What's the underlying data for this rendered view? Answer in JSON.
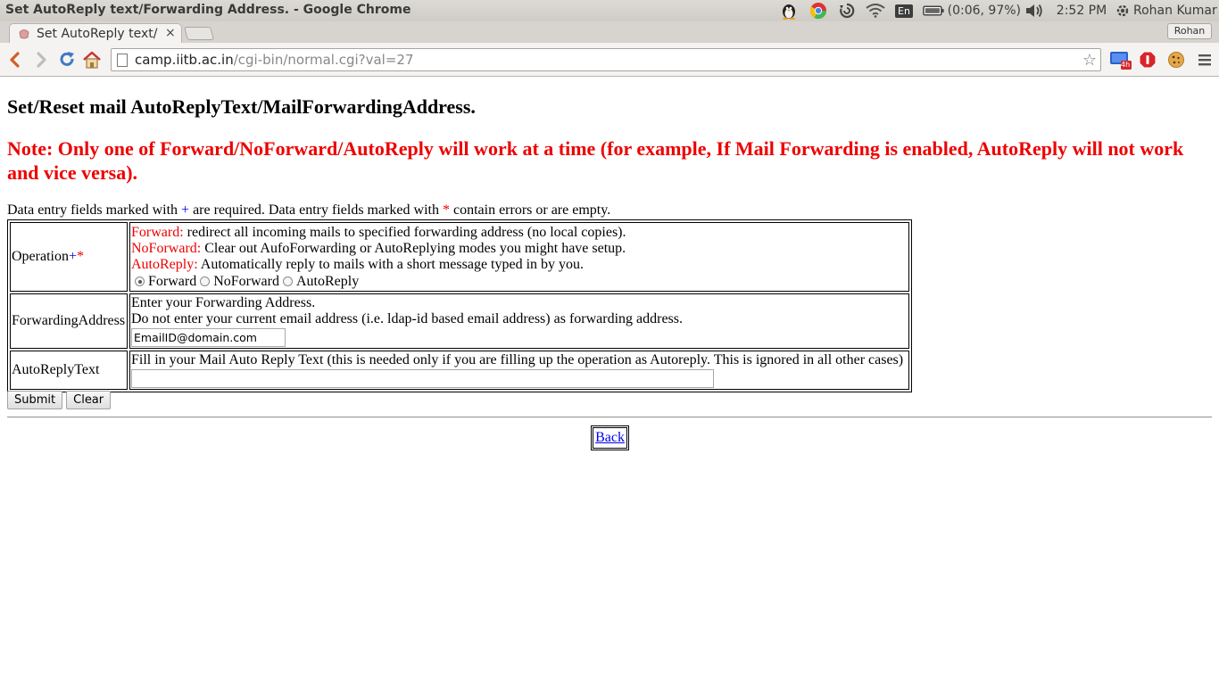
{
  "window": {
    "title": "Set AutoReply text/Forwarding Address. - Google Chrome"
  },
  "tray": {
    "keyboard_layout": "En",
    "battery": "(0:06, 97%)",
    "time": "2:52 PM",
    "user": "Rohan Kumar"
  },
  "tabs": {
    "active_title": "Set AutoReply text/F",
    "close_glyph": "×",
    "profile": "Rohan"
  },
  "omnibox": {
    "host": "camp.iitb.ac.in",
    "path": "/cgi-bin/normal.cgi?val=27"
  },
  "extension_badge": "4h",
  "page": {
    "heading": "Set/Reset mail AutoReplyText/MailForwardingAddress.",
    "note": "Note: Only one of Forward/NoForward/AutoReply will work at a time (for example, If Mail Forwarding is enabled, AutoReply will not work and vice versa).",
    "legend": {
      "part1": "Data entry fields marked with ",
      "plus": "+",
      "part2": " are required. Data entry fields marked with ",
      "star": "*",
      "part3": " contain errors or are empty."
    },
    "operation": {
      "label": "Operation",
      "plus": "+",
      "star": "*",
      "lines": [
        {
          "name": "Forward:",
          "desc": " redirect all incoming mails to specified forwarding address (no local copies)."
        },
        {
          "name": "NoForward:",
          "desc": " Clear out AufoForwarding or AutoReplying modes you might have setup."
        },
        {
          "name": "AutoReply:",
          "desc": " Automatically reply to mails with a short message typed in by you."
        }
      ],
      "options": [
        "Forward",
        "NoForward",
        "AutoReply"
      ],
      "selected": "Forward"
    },
    "forwarding": {
      "label": "ForwardingAddress",
      "line1": "Enter your Forwarding Address.",
      "line2": "Do not enter your current email address (i.e. ldap-id based email address) as forwarding address.",
      "value": "EmailID@domain.com"
    },
    "autoreply": {
      "label": "AutoReplyText",
      "instruction": "Fill in your Mail Auto Reply Text (this is needed only if you are filling up the operation as Autoreply. This is ignored in all other cases)",
      "value": ""
    },
    "buttons": {
      "submit": "Submit",
      "clear": "Clear"
    },
    "back_link": "Back"
  }
}
